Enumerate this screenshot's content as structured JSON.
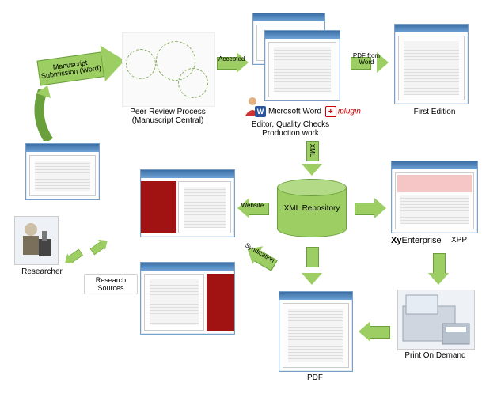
{
  "nodes": {
    "researcher": "Researcher",
    "peer_review": "Peer Review Process\n(Manuscript Central)",
    "editor_qc": "Editor, Quality Checks\nProduction work",
    "ms_word": "Microsoft Word",
    "iplugin": "plugin",
    "first_edition": "First Edition",
    "xml_repo": "XML Repository",
    "research_sources": "Research\nSources",
    "xy_enterprise": "XyEnterprise",
    "xpp": "XPP",
    "pod": "Print On Demand",
    "pdf": "PDF"
  },
  "arrows": {
    "manuscript_submission": "Manuscript\nSubmission (Word)",
    "accepted": "Accepted",
    "pdf_from_word": "PDF from\nWord",
    "xml": "XML",
    "website": "Website",
    "syndication": "Syndication"
  }
}
